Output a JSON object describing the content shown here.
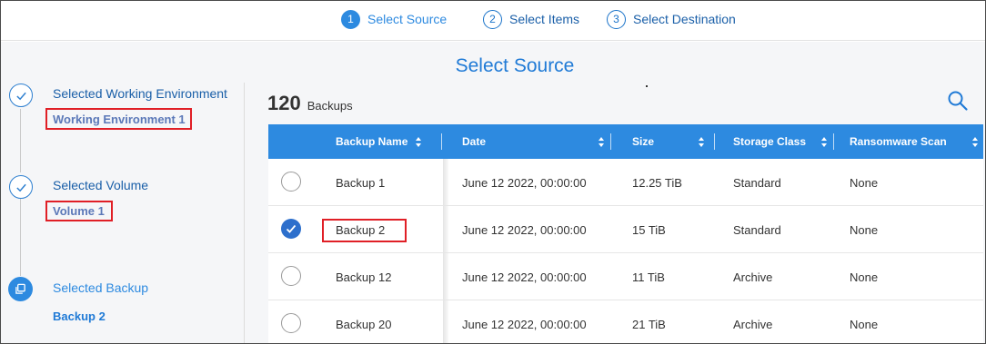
{
  "stepper": {
    "steps": [
      {
        "num": "1",
        "label": "Select Source"
      },
      {
        "num": "2",
        "label": "Select Items"
      },
      {
        "num": "3",
        "label": "Select Destination"
      }
    ]
  },
  "page": {
    "title": "Select Source"
  },
  "left": {
    "working_env_label": "Selected Working Environment",
    "working_env_value": "Working Environment 1",
    "volume_label": "Selected Volume",
    "volume_value": "Volume 1",
    "backup_label": "Selected Backup",
    "backup_value": "Backup 2"
  },
  "list": {
    "count": "120",
    "count_label": "Backups",
    "columns": [
      "Backup Name",
      "Date",
      "Size",
      "Storage Class",
      "Ransomware Scan"
    ],
    "rows": [
      {
        "name": "Backup 1",
        "date": "June 12 2022, 00:00:00",
        "size": "12.25 TiB",
        "storage": "Standard",
        "scan": "None",
        "selected": false
      },
      {
        "name": "Backup 2",
        "date": "June 12 2022, 00:00:00",
        "size": "15 TiB",
        "storage": "Standard",
        "scan": "None",
        "selected": true
      },
      {
        "name": "Backup 12",
        "date": "June 12 2022, 00:00:00",
        "size": "11 TiB",
        "storage": "Archive",
        "scan": "None",
        "selected": false
      },
      {
        "name": "Backup 20",
        "date": "June 12 2022, 00:00:00",
        "size": "21 TiB",
        "storage": "Archive",
        "scan": "None",
        "selected": false
      }
    ]
  },
  "colors": {
    "accent": "#2d8ae0",
    "highlight": "#e01f26"
  }
}
